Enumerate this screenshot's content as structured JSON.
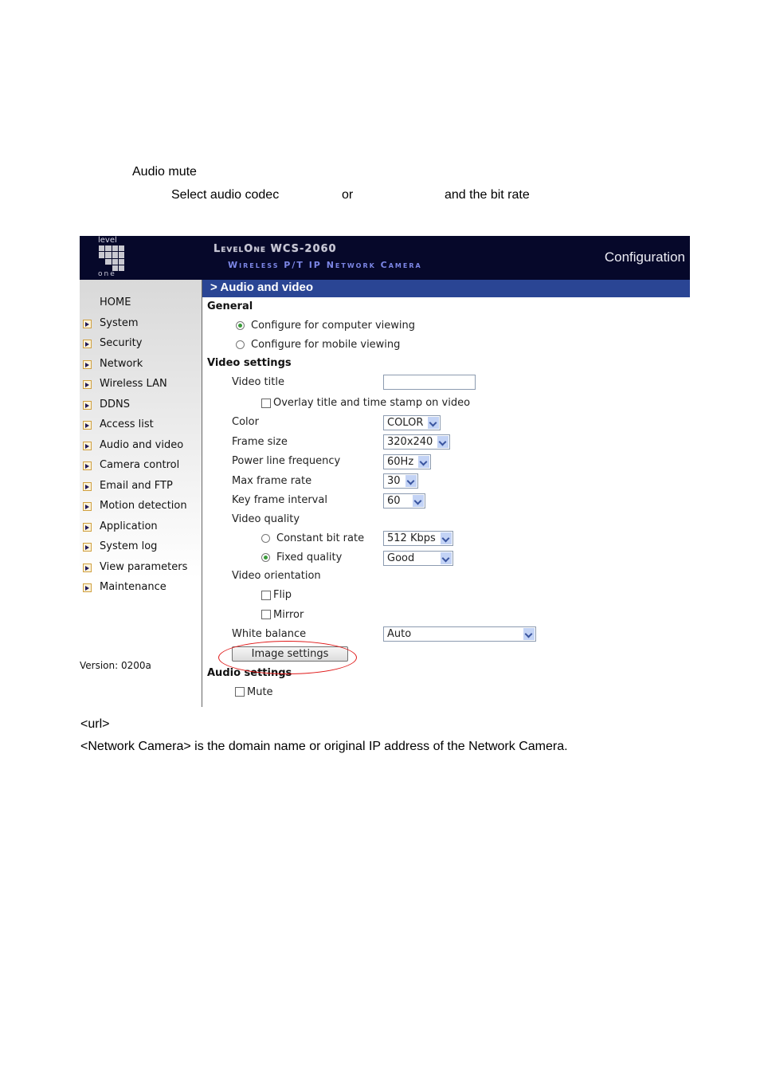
{
  "document": {
    "line1": "Audio mute",
    "line2_part1": "Select audio codec",
    "line2_part2": "or",
    "line2_part3": "and the bit rate",
    "url_label": "<url>",
    "footnote": "<Network Camera> is the domain name or original IP address of the Network Camera."
  },
  "screenshot": {
    "logo_top": "level",
    "logo_bottom": "one",
    "brand_title": "LevelOne WCS-2060",
    "brand_subtitle": "Wireless P/T IP Network Camera",
    "header_right": "Configuration",
    "page_title": "> Audio and video",
    "sidebar": {
      "home": "HOME",
      "items": [
        {
          "label": "System"
        },
        {
          "label": "Security"
        },
        {
          "label": "Network"
        },
        {
          "label": "Wireless LAN"
        },
        {
          "label": "DDNS"
        },
        {
          "label": "Access list"
        },
        {
          "label": "Audio and video"
        },
        {
          "label": "Camera control"
        },
        {
          "label": "Email and FTP"
        },
        {
          "label": "Motion detection"
        },
        {
          "label": "Application"
        },
        {
          "label": "System log"
        },
        {
          "label": "View parameters"
        },
        {
          "label": "Maintenance"
        }
      ],
      "version": "Version: 0200a"
    },
    "general": {
      "heading": "General",
      "option_computer": "Configure for computer viewing",
      "option_mobile": "Configure for mobile viewing",
      "selected": "computer"
    },
    "video": {
      "heading": "Video settings",
      "title_label": "Video title",
      "title_value": "",
      "overlay_label": "Overlay title and time stamp on video",
      "overlay_checked": false,
      "color_label": "Color",
      "color_value": "COLOR",
      "frame_size_label": "Frame size",
      "frame_size_value": "320x240",
      "power_line_label": "Power line frequency",
      "power_line_value": "60Hz",
      "max_frame_rate_label": "Max frame rate",
      "max_frame_rate_value": "30",
      "key_frame_label": "Key frame interval",
      "key_frame_value": "60",
      "quality_label": "Video quality",
      "cbr_label": "Constant bit rate",
      "cbr_value": "512 Kbps",
      "fixed_label": "Fixed quality",
      "fixed_value": "Good",
      "quality_selected": "fixed",
      "orientation_label": "Video orientation",
      "flip_label": "Flip",
      "flip_checked": false,
      "mirror_label": "Mirror",
      "mirror_checked": false,
      "white_balance_label": "White balance",
      "white_balance_value": "Auto",
      "image_settings_button": "Image settings"
    },
    "audio": {
      "heading": "Audio settings",
      "mute_label": "Mute",
      "mute_checked": false
    },
    "annotation_color": "#e01818"
  }
}
